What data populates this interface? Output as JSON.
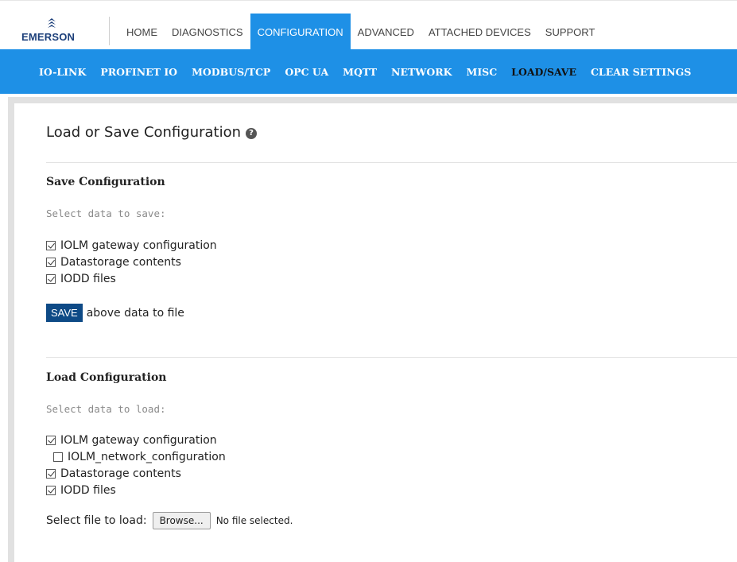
{
  "brand": {
    "name": "EMERSON"
  },
  "main_nav": [
    {
      "label": "HOME",
      "active": false
    },
    {
      "label": "DIAGNOSTICS",
      "active": false
    },
    {
      "label": "CONFIGURATION",
      "active": true
    },
    {
      "label": "ADVANCED",
      "active": false
    },
    {
      "label": "ATTACHED DEVICES",
      "active": false
    },
    {
      "label": "SUPPORT",
      "active": false
    }
  ],
  "sub_nav": [
    {
      "label": "IO-LINK",
      "active": false
    },
    {
      "label": "PROFINET IO",
      "active": false
    },
    {
      "label": "MODBUS/TCP",
      "active": false
    },
    {
      "label": "OPC UA",
      "active": false
    },
    {
      "label": "MQTT",
      "active": false
    },
    {
      "label": "NETWORK",
      "active": false
    },
    {
      "label": "MISC",
      "active": false
    },
    {
      "label": "LOAD/SAVE",
      "active": true
    },
    {
      "label": "CLEAR SETTINGS",
      "active": false
    }
  ],
  "page": {
    "title": "Load or Save Configuration",
    "help_icon": "?"
  },
  "save_section": {
    "heading": "Save Configuration",
    "hint": "Select data to save:",
    "options": [
      {
        "label": "IOLM gateway configuration",
        "checked": true
      },
      {
        "label": "Datastorage contents",
        "checked": true
      },
      {
        "label": "IODD files",
        "checked": true
      }
    ],
    "save_button": "SAVE",
    "save_suffix": "above data to file"
  },
  "load_section": {
    "heading": "Load Configuration",
    "hint": "Select data to load:",
    "options": [
      {
        "label": "IOLM gateway configuration",
        "checked": true,
        "indent": false
      },
      {
        "label": "IOLM_network_configuration",
        "checked": false,
        "indent": true
      },
      {
        "label": "Datastorage contents",
        "checked": true,
        "indent": false
      },
      {
        "label": "IODD files",
        "checked": true,
        "indent": false
      }
    ],
    "file_label": "Select file to load:",
    "browse_button": "Browse...",
    "file_status": "No file selected."
  },
  "colors": {
    "accent_blue": "#1e90e6",
    "save_button": "#0e4a86",
    "brand_blue": "#1c3f7a"
  }
}
